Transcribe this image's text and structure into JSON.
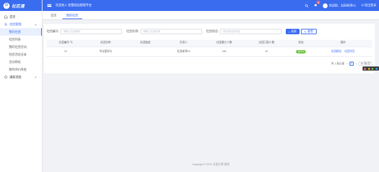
{
  "sidebar": {
    "logo_mark": "O",
    "logo_text": "社区通",
    "items": [
      {
        "label": "首页",
        "icon": "home-icon"
      },
      {
        "label": "社团管理",
        "icon": "users-icon",
        "expanded": true,
        "children": [
          "我的社团",
          "社团列表",
          "我的社团活动",
          "社团活动记录",
          "活动审核",
          "教师评价审批"
        ]
      },
      {
        "label": "通知消息",
        "icon": "bell-outline-icon",
        "expanded": false
      }
    ]
  },
  "topbar": {
    "welcome": "欢迎进入 智慧校园管理平台",
    "notify_count": "1",
    "user": "欢迎您，社团老师01",
    "logout": "退出登录"
  },
  "tabs": [
    {
      "label": "首页",
      "active": false
    },
    {
      "label": "我的社团",
      "active": true
    }
  ],
  "search": {
    "fields": [
      {
        "label": "社团编号:",
        "placeholder": "请输入社团编号"
      },
      {
        "label": "社团名称:",
        "placeholder": "请输入社团名称"
      },
      {
        "label": "社团状态:",
        "placeholder": "请选择社团状态"
      }
    ],
    "search_button": "搜索",
    "reset_button": "重置"
  },
  "table": {
    "columns": [
      "社团编号",
      "社团名称",
      "社团描述",
      "负责人",
      "社团最大人数",
      "社团已报人数",
      "状态",
      "操作"
    ],
    "rows": [
      {
        "id": "21",
        "name": "书法爱好社",
        "desc": "",
        "owner": "社团老师01",
        "max": "100",
        "enrolled": "41",
        "status": "进行中",
        "ops": [
          "社团报名",
          "社团学员"
        ]
      }
    ]
  },
  "pagination": {
    "total": "共 1 条记录",
    "current": "1",
    "page_size": "10 条/页"
  },
  "footer": "Copyright © 2021 社团小帮 版权",
  "colors": {
    "primary": "#3a6cf0",
    "success": "#67c23a"
  }
}
